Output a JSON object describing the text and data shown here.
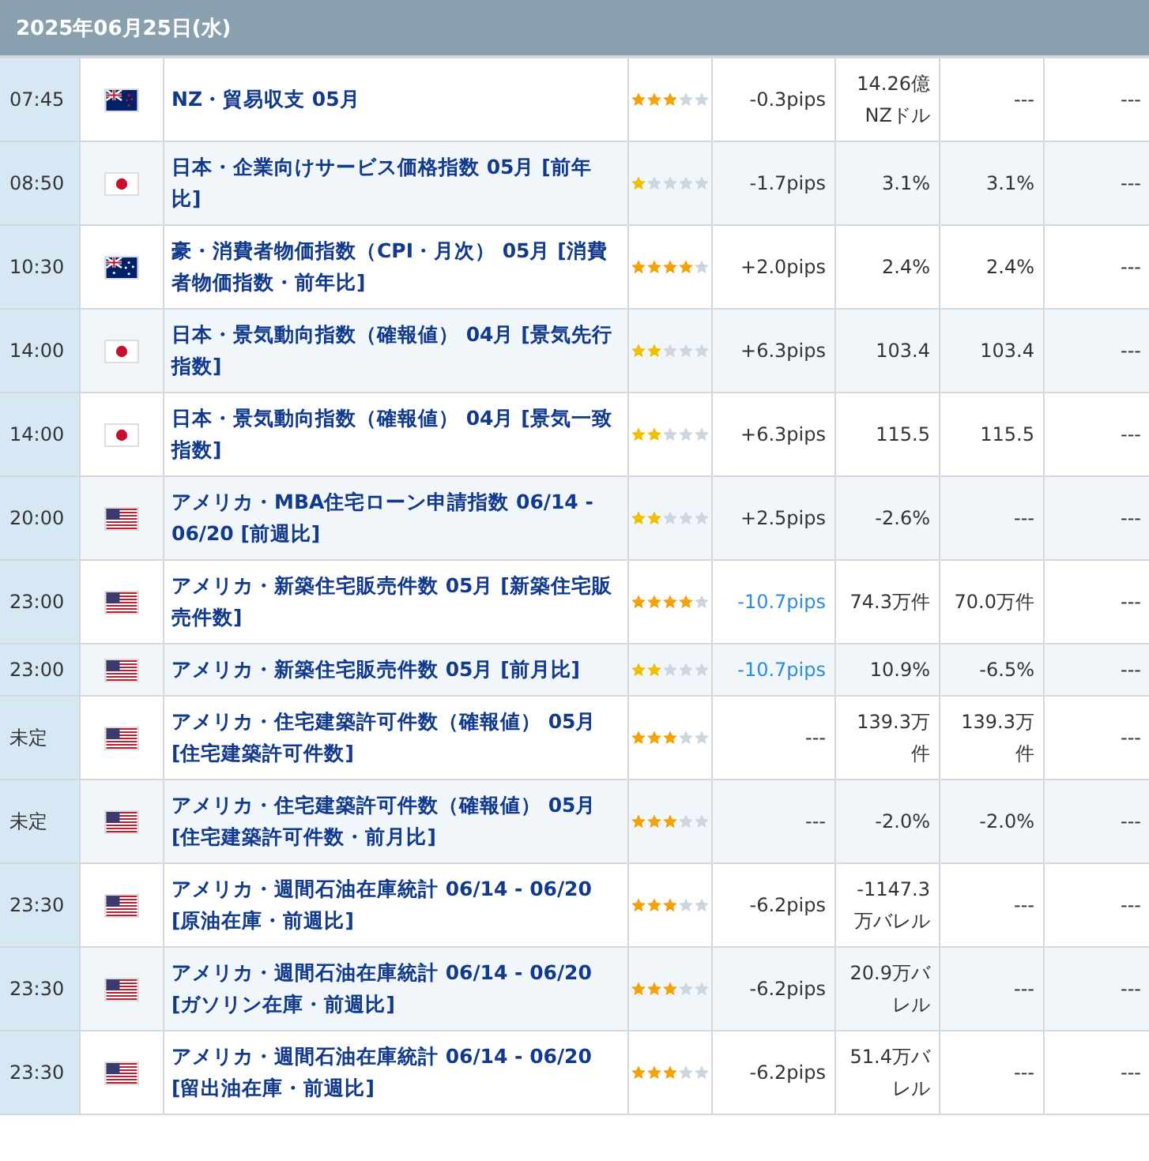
{
  "date_header": "2025年06月25日(水)",
  "rows": [
    {
      "time": "07:45",
      "kind": "nz",
      "event": "NZ・貿易収支 05月",
      "stars": 3,
      "pips": "-0.3pips",
      "pips_highlight": false,
      "actual": "14.26億NZドル",
      "forecast": "---",
      "previous": "---"
    },
    {
      "time": "08:50",
      "kind": "jp",
      "event": "日本・企業向けサービス価格指数 05月 [前年比]",
      "stars": 1,
      "pips": "-1.7pips",
      "pips_highlight": false,
      "actual": "3.1%",
      "forecast": "3.1%",
      "previous": "---"
    },
    {
      "time": "10:30",
      "kind": "au",
      "event": "豪・消費者物価指数（CPI・月次） 05月 [消費者物価指数・前年比]",
      "stars": 4,
      "pips": "+2.0pips",
      "pips_highlight": false,
      "actual": "2.4%",
      "forecast": "2.4%",
      "previous": "---"
    },
    {
      "time": "14:00",
      "kind": "jp",
      "event": "日本・景気動向指数（確報値） 04月 [景気先行指数]",
      "stars": 2,
      "pips": "+6.3pips",
      "pips_highlight": false,
      "actual": "103.4",
      "forecast": "103.4",
      "previous": "---"
    },
    {
      "time": "14:00",
      "kind": "jp",
      "event": "日本・景気動向指数（確報値） 04月 [景気一致指数]",
      "stars": 2,
      "pips": "+6.3pips",
      "pips_highlight": false,
      "actual": "115.5",
      "forecast": "115.5",
      "previous": "---"
    },
    {
      "time": "20:00",
      "kind": "us",
      "event": "アメリカ・MBA住宅ローン申請指数 06/14 - 06/20 [前週比]",
      "stars": 2,
      "pips": "+2.5pips",
      "pips_highlight": false,
      "actual": "-2.6%",
      "forecast": "---",
      "previous": "---"
    },
    {
      "time": "23:00",
      "kind": "us",
      "event": "アメリカ・新築住宅販売件数 05月 [新築住宅販売件数]",
      "stars": 4,
      "pips": "-10.7pips",
      "pips_highlight": true,
      "actual": "74.3万件",
      "forecast": "70.0万件",
      "previous": "---"
    },
    {
      "time": "23:00",
      "kind": "us",
      "event": "アメリカ・新築住宅販売件数 05月 [前月比]",
      "stars": 2,
      "pips": "-10.7pips",
      "pips_highlight": true,
      "actual": "10.9%",
      "forecast": "-6.5%",
      "previous": "---"
    },
    {
      "time": "未定",
      "kind": "us",
      "event": "アメリカ・住宅建築許可件数（確報値） 05月 [住宅建築許可件数]",
      "stars": 3,
      "pips": "---",
      "pips_highlight": false,
      "actual": "139.3万件",
      "forecast": "139.3万件",
      "previous": "---"
    },
    {
      "time": "未定",
      "kind": "us",
      "event": "アメリカ・住宅建築許可件数（確報値） 05月 [住宅建築許可件数・前月比]",
      "stars": 3,
      "pips": "---",
      "pips_highlight": false,
      "actual": "-2.0%",
      "forecast": "-2.0%",
      "previous": "---"
    },
    {
      "time": "23:30",
      "kind": "us",
      "event": "アメリカ・週間石油在庫統計 06/14 - 06/20 [原油在庫・前週比]",
      "stars": 3,
      "pips": "-6.2pips",
      "pips_highlight": false,
      "actual": "-1147.3万バレル",
      "forecast": "---",
      "previous": "---"
    },
    {
      "time": "23:30",
      "kind": "us",
      "event": "アメリカ・週間石油在庫統計 06/14 - 06/20 [ガソリン在庫・前週比]",
      "stars": 3,
      "pips": "-6.2pips",
      "pips_highlight": false,
      "actual": "20.9万バレル",
      "forecast": "---",
      "previous": "---"
    },
    {
      "time": "23:30",
      "kind": "us",
      "event": "アメリカ・週間石油在庫統計 06/14 - 06/20 [留出油在庫・前週比]",
      "stars": 3,
      "pips": "-6.2pips",
      "pips_highlight": false,
      "actual": "51.4万バレル",
      "forecast": "---",
      "previous": "---"
    }
  ]
}
